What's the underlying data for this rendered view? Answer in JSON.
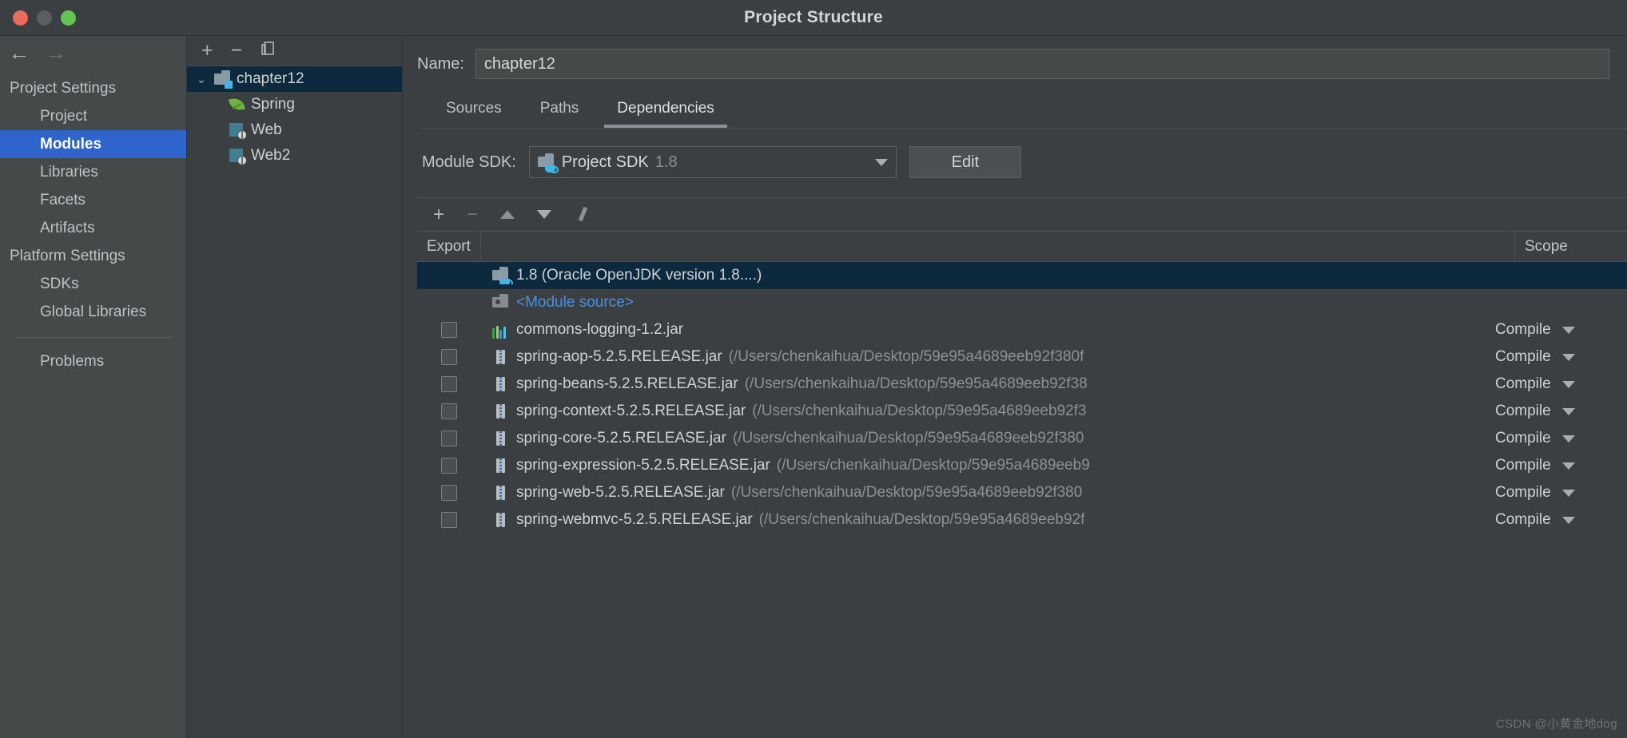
{
  "window": {
    "title": "Project Structure",
    "controls": {
      "close": "close-button",
      "minimize": "minimize-button",
      "zoom": "zoom-button"
    }
  },
  "nav": {
    "back_icon": "←",
    "forward_icon": "→",
    "items": [
      {
        "label": "Project Settings",
        "type": "group",
        "selected": false
      },
      {
        "label": "Project",
        "type": "child",
        "selected": false
      },
      {
        "label": "Modules",
        "type": "child",
        "selected": true
      },
      {
        "label": "Libraries",
        "type": "child",
        "selected": false
      },
      {
        "label": "Facets",
        "type": "child",
        "selected": false
      },
      {
        "label": "Artifacts",
        "type": "child",
        "selected": false
      },
      {
        "label": "Platform Settings",
        "type": "group",
        "selected": false
      },
      {
        "label": "SDKs",
        "type": "child",
        "selected": false
      },
      {
        "label": "Global Libraries",
        "type": "child",
        "selected": false
      }
    ],
    "problems": "Problems"
  },
  "tree": {
    "toolbar": {
      "add": "+",
      "remove": "−",
      "copy": "copy-icon"
    },
    "nodes": [
      {
        "label": "chapter12",
        "icon": "module-icon",
        "selected": true,
        "expanded": true,
        "level": 0
      },
      {
        "label": "Spring",
        "icon": "spring-icon",
        "selected": false,
        "level": 1
      },
      {
        "label": "Web",
        "icon": "web-icon",
        "selected": false,
        "level": 1
      },
      {
        "label": "Web2",
        "icon": "web-icon",
        "selected": false,
        "level": 1
      }
    ]
  },
  "main": {
    "name_label": "Name:",
    "name_value": "chapter12",
    "tabs": [
      {
        "label": "Sources",
        "active": false
      },
      {
        "label": "Paths",
        "active": false
      },
      {
        "label": "Dependencies",
        "active": true
      }
    ],
    "sdk_label": "Module SDK:",
    "sdk_value": "Project SDK",
    "sdk_version": "1.8",
    "edit_label": "Edit",
    "dep_toolbar": {
      "add": "+",
      "remove": "−",
      "up": "move-up",
      "down": "move-down",
      "edit": "edit-pencil"
    },
    "table": {
      "headers": {
        "export": "Export",
        "name": "",
        "scope": "Scope"
      },
      "rows": [
        {
          "export": null,
          "icon": "jdk-icon",
          "name": "1.8 (Oracle OpenJDK version 1.8....)",
          "path": "",
          "scope": "",
          "selected": true,
          "link": false
        },
        {
          "export": null,
          "icon": "module-source-icon",
          "name": "<Module source>",
          "path": "",
          "scope": "",
          "selected": false,
          "link": true
        },
        {
          "export": false,
          "icon": "library-icon",
          "name": "commons-logging-1.2.jar",
          "path": "",
          "scope": "Compile",
          "selected": false,
          "link": false
        },
        {
          "export": false,
          "icon": "jar-icon",
          "name": "spring-aop-5.2.5.RELEASE.jar",
          "path": "(/Users/chenkaihua/Desktop/59e95a4689eeb92f380f",
          "scope": "Compile",
          "selected": false,
          "link": false
        },
        {
          "export": false,
          "icon": "jar-icon",
          "name": "spring-beans-5.2.5.RELEASE.jar",
          "path": "(/Users/chenkaihua/Desktop/59e95a4689eeb92f38",
          "scope": "Compile",
          "selected": false,
          "link": false
        },
        {
          "export": false,
          "icon": "jar-icon",
          "name": "spring-context-5.2.5.RELEASE.jar",
          "path": "(/Users/chenkaihua/Desktop/59e95a4689eeb92f3",
          "scope": "Compile",
          "selected": false,
          "link": false
        },
        {
          "export": false,
          "icon": "jar-icon",
          "name": "spring-core-5.2.5.RELEASE.jar",
          "path": "(/Users/chenkaihua/Desktop/59e95a4689eeb92f380",
          "scope": "Compile",
          "selected": false,
          "link": false
        },
        {
          "export": false,
          "icon": "jar-icon",
          "name": "spring-expression-5.2.5.RELEASE.jar",
          "path": "(/Users/chenkaihua/Desktop/59e95a4689eeb9",
          "scope": "Compile",
          "selected": false,
          "link": false
        },
        {
          "export": false,
          "icon": "jar-icon",
          "name": "spring-web-5.2.5.RELEASE.jar",
          "path": "(/Users/chenkaihua/Desktop/59e95a4689eeb92f380",
          "scope": "Compile",
          "selected": false,
          "link": false
        },
        {
          "export": false,
          "icon": "jar-icon",
          "name": "spring-webmvc-5.2.5.RELEASE.jar",
          "path": "(/Users/chenkaihua/Desktop/59e95a4689eeb92f",
          "scope": "Compile",
          "selected": false,
          "link": false
        }
      ]
    }
  },
  "watermark": "CSDN @小黄金地dog",
  "colors": {
    "accent_selected_nav": "#2f65ca",
    "accent_selected_row": "#0d293e",
    "background": "#3c3f41",
    "sidebar_background": "#45494a",
    "link": "#4a90e2"
  }
}
